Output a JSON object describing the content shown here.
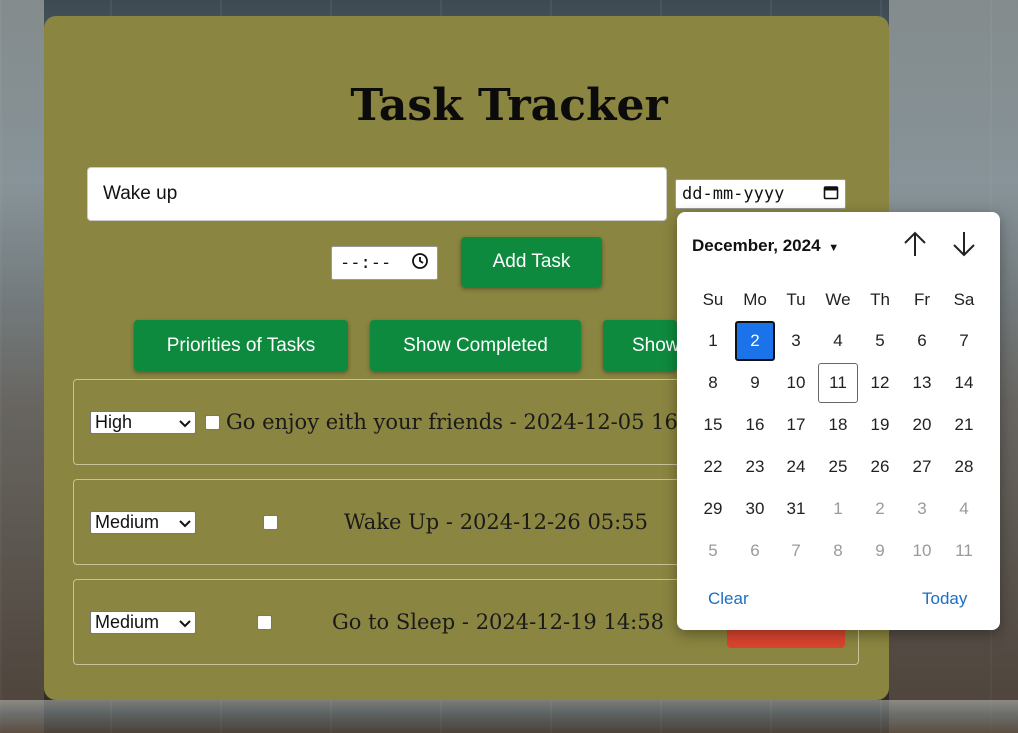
{
  "app": {
    "title": "Task Tracker",
    "task_input_value": "Wake up",
    "date_placeholder": "dd-mm-yyyy",
    "time_placeholder": "--:--",
    "add_button": "Add Task",
    "filter_buttons": [
      "Priorities of Tasks",
      "Show Completed",
      "Show"
    ]
  },
  "tasks": [
    {
      "priority": "High",
      "text": "Go enjoy eith your friends - 2024-12-05 16"
    },
    {
      "priority": "Medium",
      "text": "Wake Up - 2024-12-26 05:55"
    },
    {
      "priority": "Medium",
      "text": "Go to Sleep - 2024-12-19 14:58"
    }
  ],
  "calendar": {
    "month_label": "December, 2024",
    "days_of_week": [
      "Su",
      "Mo",
      "Tu",
      "We",
      "Th",
      "Fr",
      "Sa"
    ],
    "weeks": [
      [
        "1",
        "2",
        "3",
        "4",
        "5",
        "6",
        "7"
      ],
      [
        "8",
        "9",
        "10",
        "11",
        "12",
        "13",
        "14"
      ],
      [
        "15",
        "16",
        "17",
        "18",
        "19",
        "20",
        "21"
      ],
      [
        "22",
        "23",
        "24",
        "25",
        "26",
        "27",
        "28"
      ],
      [
        "29",
        "30",
        "31",
        "1",
        "2",
        "3",
        "4"
      ],
      [
        "5",
        "6",
        "7",
        "8",
        "9",
        "10",
        "11"
      ]
    ],
    "selected_day": "2",
    "today_day": "11",
    "clear_label": "Clear",
    "today_label": "Today"
  },
  "colors": {
    "panel": "#8a8540",
    "button_green": "#0e8a3e",
    "selected_blue": "#1a73e8",
    "delete_red": "#d9442f"
  },
  "icons": {
    "date": "calendar-icon",
    "time": "clock-icon",
    "dropdown": "chevron-down-icon",
    "prev": "arrow-up-icon",
    "next": "arrow-down-icon"
  }
}
